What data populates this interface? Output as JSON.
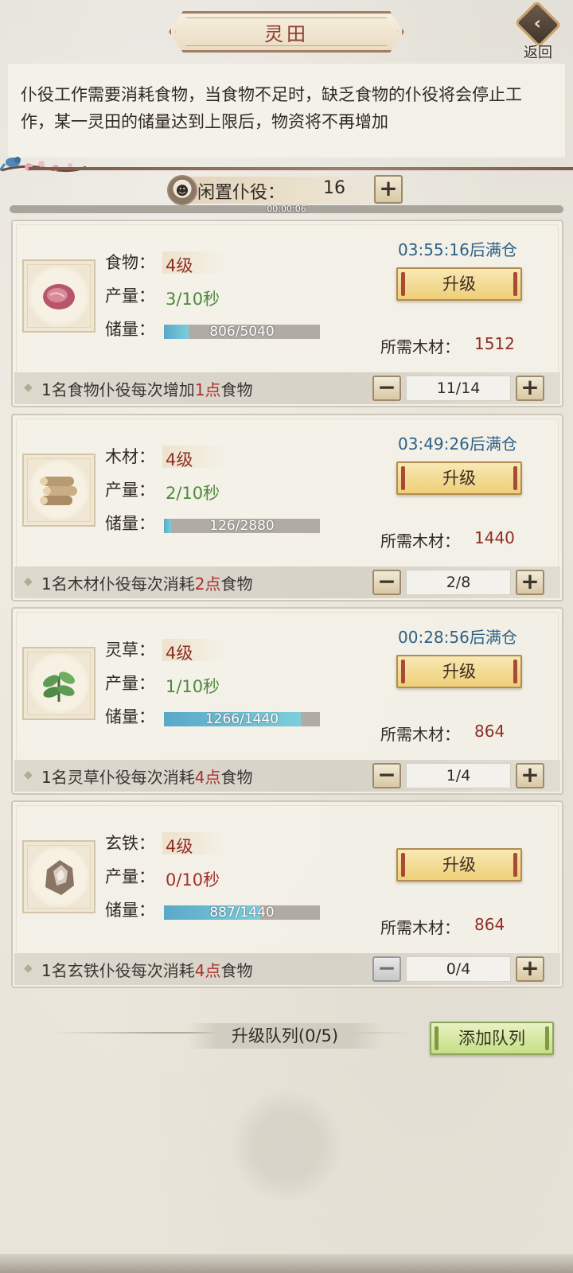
{
  "header": {
    "title": "灵田",
    "back_label": "返回"
  },
  "description": "仆役工作需要消耗食物，当食物不足时，缺乏食物的仆役将会停止工作，某一灵田的储量达到上限后，物资将不再增加",
  "idle": {
    "label": "闲置仆役：",
    "count": "16",
    "progress": 0.0,
    "timer": "00:00:06"
  },
  "labels": {
    "output": "产量：",
    "storage": "储量：",
    "cost": "所需木材：",
    "upgrade": "升级"
  },
  "fields": [
    {
      "name": "食物：",
      "level": "4级",
      "rate": "3/10秒",
      "storage_text": "806/5040",
      "storage_fraction": 0.16,
      "timer": "03:55:16后满仓",
      "cost": "1512",
      "footer_prefix": "1名食物仆役每次增加",
      "footer_highlight": "1点",
      "footer_suffix": "食物",
      "workers": "11/14",
      "icon": "meat-icon"
    },
    {
      "name": "木材：",
      "level": "4级",
      "rate": "2/10秒",
      "storage_text": "126/2880",
      "storage_fraction": 0.044,
      "timer": "03:49:26后满仓",
      "cost": "1440",
      "footer_prefix": "1名木材仆役每次消耗",
      "footer_highlight": "2点",
      "footer_suffix": "食物",
      "workers": "2/8",
      "icon": "wood-logs-icon"
    },
    {
      "name": "灵草：",
      "level": "4级",
      "rate": "1/10秒",
      "storage_text": "1266/1440",
      "storage_fraction": 0.88,
      "timer": "00:28:56后满仓",
      "cost": "864",
      "footer_prefix": "1名灵草仆役每次消耗",
      "footer_highlight": "4点",
      "footer_suffix": "食物",
      "workers": "1/4",
      "icon": "herb-icon"
    },
    {
      "name": "玄铁：",
      "level": "4级",
      "rate": "0/10秒",
      "storage_text": "887/1440",
      "storage_fraction": 0.616,
      "timer": "",
      "cost": "864",
      "footer_prefix": "1名玄铁仆役每次消耗",
      "footer_highlight": "4点",
      "footer_suffix": "食物",
      "workers": "0/4",
      "icon": "iron-ore-icon"
    }
  ],
  "queue": {
    "label": "升级队列(0/5)",
    "add_label": "添加队列"
  },
  "colors": {
    "level": "#8f2e25",
    "rate": "#4f8a3c",
    "timer": "#2f6185",
    "bar": "#5aa8c8"
  }
}
